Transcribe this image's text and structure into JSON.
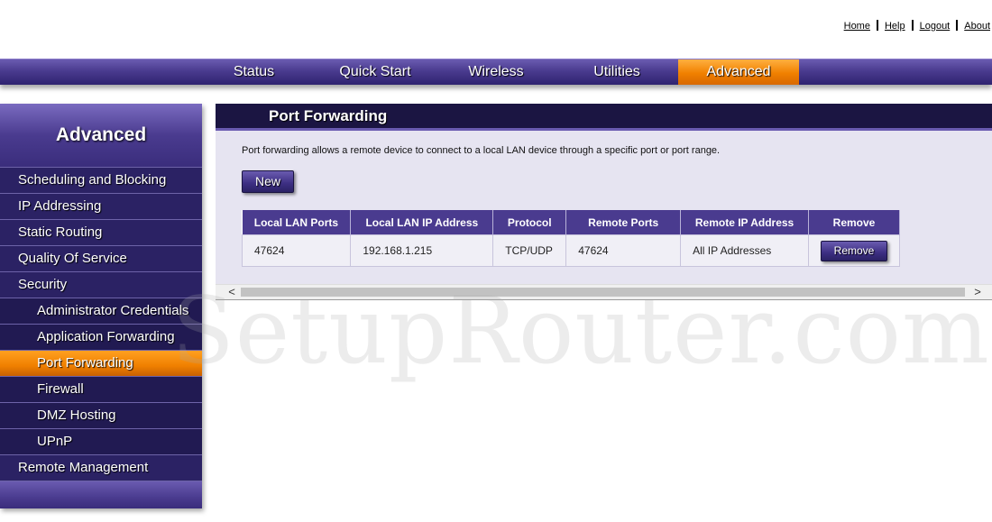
{
  "top_links": [
    "Home",
    "Help",
    "Logout",
    "About"
  ],
  "nav": {
    "tabs": [
      "Status",
      "Quick Start",
      "Wireless",
      "Utilities",
      "Advanced"
    ],
    "active": "Advanced"
  },
  "sidebar": {
    "title": "Advanced",
    "items": [
      {
        "label": "Scheduling and Blocking"
      },
      {
        "label": "IP Addressing"
      },
      {
        "label": "Static Routing"
      },
      {
        "label": "Quality Of Service"
      },
      {
        "label": "Security"
      },
      {
        "label": "Administrator Credentials"
      },
      {
        "label": "Application Forwarding"
      },
      {
        "label": "Port Forwarding"
      },
      {
        "label": "Firewall"
      },
      {
        "label": "DMZ Hosting"
      },
      {
        "label": "UPnP"
      },
      {
        "label": "Remote Management"
      }
    ],
    "active": "Port Forwarding"
  },
  "panel": {
    "title": "Port Forwarding",
    "description": "Port forwarding allows a remote device to connect to a local LAN device through a specific port or port range.",
    "new_button": "New",
    "table": {
      "headers": [
        "Local LAN Ports",
        "Local LAN IP Address",
        "Protocol",
        "Remote Ports",
        "Remote IP Address",
        "Remove"
      ],
      "rows": [
        {
          "local_ports": "47624",
          "local_ip": "192.168.1.215",
          "protocol": "TCP/UDP",
          "remote_ports": "47624",
          "remote_ip": "All IP Addresses",
          "remove_label": "Remove"
        }
      ]
    }
  },
  "scrollbar": {
    "left_arrow": "<",
    "right_arrow": ">"
  },
  "watermark": "SetupRouter.com",
  "colors": {
    "nav_purple": "#4a3b8f",
    "active_orange": "#f08000",
    "title_bar": "#1b1542"
  }
}
